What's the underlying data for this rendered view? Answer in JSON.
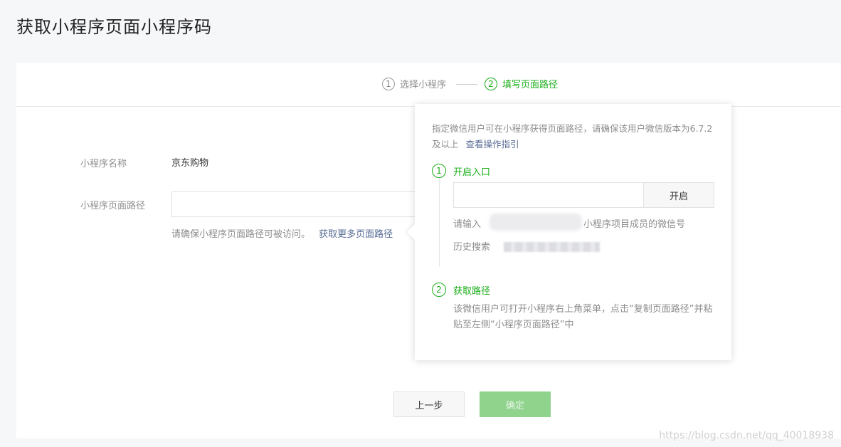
{
  "page": {
    "title": "获取小程序页面小程序码"
  },
  "steps": [
    {
      "num": "1",
      "label": "选择小程序"
    },
    {
      "num": "2",
      "label": "填写页面路径"
    }
  ],
  "form": {
    "name_label": "小程序名称",
    "name_value": "京东购物",
    "path_label": "小程序页面路径",
    "path_value": "",
    "path_hint": "请确保小程序页面路径可被访问。",
    "path_hint_link": "获取更多页面路径"
  },
  "popover": {
    "desc": "指定微信用户可在小程序获得页面路径，请确保该用户微信版本为6.7.2及以上",
    "desc_link": "查看操作指引",
    "step1_num": "1",
    "step1_title": "开启入口",
    "wechat_input_value": "",
    "open_button": "开启",
    "input_hint_prefix": "请输入",
    "input_hint_suffix": "小程序项目成员的微信号",
    "history_label": "历史搜索",
    "step2_num": "2",
    "step2_title": "获取路径",
    "step2_desc": "该微信用户可打开小程序右上角菜单，点击“复制页面路径”并粘贴至左侧“小程序页面路径”中"
  },
  "actions": {
    "prev": "上一步",
    "confirm": "确定"
  },
  "watermark": "https://blog.csdn.net/qq_40018938",
  "colors": {
    "accent": "#1aad19",
    "link": "#576b95",
    "confirm_disabled": "#8fd38c"
  }
}
